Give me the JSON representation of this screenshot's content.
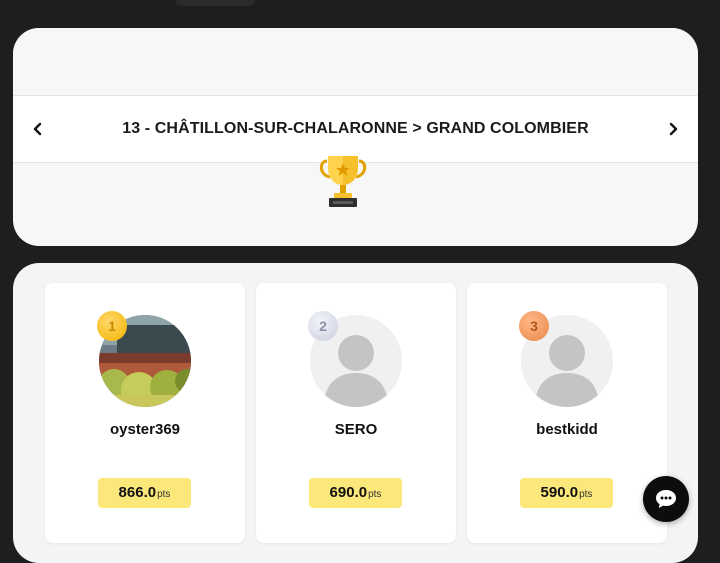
{
  "stage": {
    "title": "13 - CHÂTILLON-SUR-CHALARONNE > GRAND COLOMBIER",
    "prev_icon": "chevron-left-icon",
    "next_icon": "chevron-right-icon"
  },
  "trophy_icon": "trophy-icon",
  "podium": [
    {
      "rank": "1",
      "name": "oyster369",
      "score": "866.0",
      "unit": "pts",
      "medal_color": "#f4b400"
    },
    {
      "rank": "2",
      "name": "SERO",
      "score": "690.0",
      "unit": "pts",
      "medal_color": "#c9cddd"
    },
    {
      "rank": "3",
      "name": "bestkidd",
      "score": "590.0",
      "unit": "pts",
      "medal_color": "#e9874a"
    }
  ],
  "chat_icon": "chat-bubble-icon",
  "colors": {
    "background": "#1e1e1e",
    "score_badge": "#fbe77a",
    "card": "#ffffff"
  }
}
